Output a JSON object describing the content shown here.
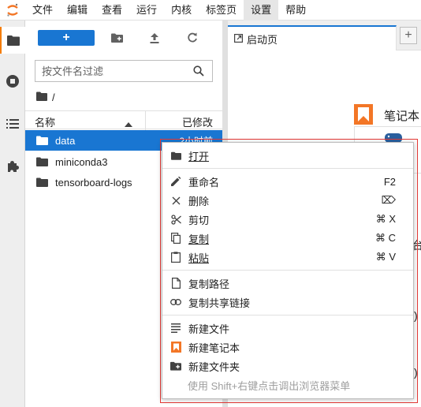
{
  "menubar": {
    "items": [
      "文件",
      "编辑",
      "查看",
      "运行",
      "内核",
      "标签页",
      "设置",
      "帮助"
    ],
    "active_index": 6
  },
  "filebrowser": {
    "new_button_label": "+",
    "filter_placeholder": "按文件名过滤",
    "breadcrumb": "/",
    "columns": {
      "name": "名称",
      "modified": "已修改"
    },
    "files": [
      {
        "name": "data",
        "modified": "2小时前",
        "selected": true
      },
      {
        "name": "miniconda3",
        "modified": "",
        "selected": false
      },
      {
        "name": "tensorboard-logs",
        "modified": "",
        "selected": false
      }
    ]
  },
  "main": {
    "tab_label": "启动页",
    "add_tab_label": "+",
    "section_title": "笔记本",
    "fragments": [
      "台",
      ")",
      ")"
    ]
  },
  "context_menu": {
    "items": {
      "open": {
        "label": "打开",
        "shortcut": ""
      },
      "rename": {
        "label": "重命名",
        "shortcut": "F2"
      },
      "delete": {
        "label": "删除",
        "shortcut": "⌦"
      },
      "cut": {
        "label": "剪切",
        "shortcut": "⌘ X"
      },
      "copy": {
        "label": "复制",
        "shortcut": "⌘ C"
      },
      "paste": {
        "label": "粘贴",
        "shortcut": "⌘ V"
      },
      "copy_path": {
        "label": "复制路径",
        "shortcut": ""
      },
      "copy_share_link": {
        "label": "复制共享链接",
        "shortcut": ""
      },
      "new_file": {
        "label": "新建文件",
        "shortcut": ""
      },
      "new_notebook": {
        "label": "新建笔记本",
        "shortcut": ""
      },
      "new_folder": {
        "label": "新建文件夹",
        "shortcut": ""
      }
    },
    "hint": "使用 Shift+右键点击调出浏览器菜单"
  },
  "colors": {
    "accent": "#1976d2",
    "brand_orange": "#f37626",
    "highlight_outline": "#e53935"
  }
}
